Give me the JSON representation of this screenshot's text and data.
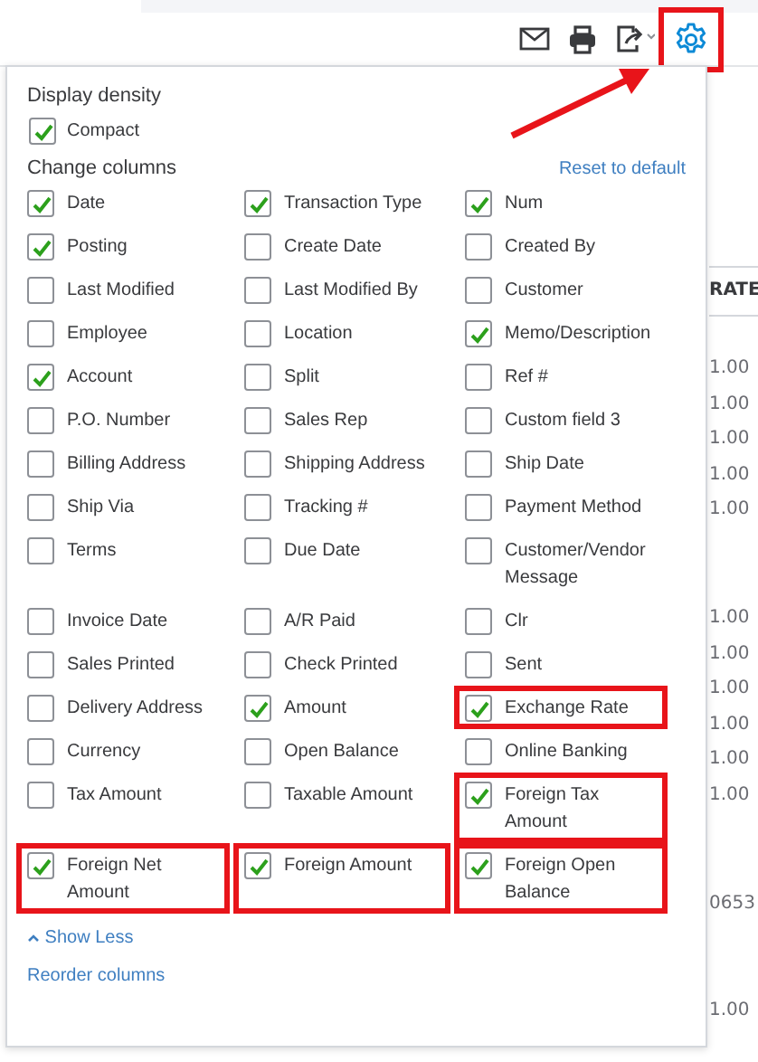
{
  "toolbar": {
    "icons": [
      {
        "kind": "mail"
      },
      {
        "kind": "print"
      },
      {
        "kind": "export"
      },
      {
        "kind": "settings",
        "highlighted": true
      }
    ]
  },
  "annotation": {
    "arrow": true
  },
  "table_background": {
    "header": "RATE",
    "groups": [
      [
        "1.00",
        "1.00",
        "1.00",
        "1.00",
        "1.00"
      ],
      [
        "1.00",
        "1.00",
        "1.00",
        "1.00",
        "1.00",
        "1.00"
      ],
      [
        "0653"
      ],
      [
        "1.00"
      ]
    ]
  },
  "display_density": {
    "label": "Display density",
    "options": [
      {
        "label": "Compact",
        "checked": true
      }
    ]
  },
  "change_columns": {
    "label": "Change columns",
    "reset_link": "Reset to default",
    "items": [
      {
        "label": "Date",
        "checked": true,
        "highlighted": false
      },
      {
        "label": "Transaction Type",
        "checked": true,
        "highlighted": false
      },
      {
        "label": "Num",
        "checked": true,
        "highlighted": false
      },
      {
        "label": "Posting",
        "checked": true,
        "highlighted": false
      },
      {
        "label": "Create Date",
        "checked": false,
        "highlighted": false
      },
      {
        "label": "Created By",
        "checked": false,
        "highlighted": false
      },
      {
        "label": "Last Modified",
        "checked": false,
        "highlighted": false
      },
      {
        "label": "Last Modified By",
        "checked": false,
        "highlighted": false
      },
      {
        "label": "Customer",
        "checked": false,
        "highlighted": false
      },
      {
        "label": "Employee",
        "checked": false,
        "highlighted": false
      },
      {
        "label": "Location",
        "checked": false,
        "highlighted": false
      },
      {
        "label": "Memo/Description",
        "checked": true,
        "highlighted": false
      },
      {
        "label": "Account",
        "checked": true,
        "highlighted": false
      },
      {
        "label": "Split",
        "checked": false,
        "highlighted": false
      },
      {
        "label": "Ref #",
        "checked": false,
        "highlighted": false
      },
      {
        "label": "P.O. Number",
        "checked": false,
        "highlighted": false
      },
      {
        "label": "Sales Rep",
        "checked": false,
        "highlighted": false
      },
      {
        "label": "Custom field 3",
        "checked": false,
        "highlighted": false
      },
      {
        "label": "Billing Address",
        "checked": false,
        "highlighted": false
      },
      {
        "label": "Shipping Address",
        "checked": false,
        "highlighted": false
      },
      {
        "label": "Ship Date",
        "checked": false,
        "highlighted": false
      },
      {
        "label": "Ship Via",
        "checked": false,
        "highlighted": false
      },
      {
        "label": "Tracking #",
        "checked": false,
        "highlighted": false
      },
      {
        "label": "Payment Method",
        "checked": false,
        "highlighted": false
      },
      {
        "label": "Terms",
        "checked": false,
        "highlighted": false
      },
      {
        "label": "Due Date",
        "checked": false,
        "highlighted": false
      },
      {
        "label": "Customer/Vendor Message",
        "checked": false,
        "highlighted": false
      },
      {
        "label": "Invoice Date",
        "checked": false,
        "highlighted": false
      },
      {
        "label": "A/R Paid",
        "checked": false,
        "highlighted": false
      },
      {
        "label": "Clr",
        "checked": false,
        "highlighted": false
      },
      {
        "label": "Sales Printed",
        "checked": false,
        "highlighted": false
      },
      {
        "label": "Check Printed",
        "checked": false,
        "highlighted": false
      },
      {
        "label": "Sent",
        "checked": false,
        "highlighted": false
      },
      {
        "label": "Delivery Address",
        "checked": false,
        "highlighted": false
      },
      {
        "label": "Amount",
        "checked": true,
        "highlighted": false
      },
      {
        "label": "Exchange Rate",
        "checked": true,
        "highlighted": true
      },
      {
        "label": "Currency",
        "checked": false,
        "highlighted": false
      },
      {
        "label": "Open Balance",
        "checked": false,
        "highlighted": false
      },
      {
        "label": "Online Banking",
        "checked": false,
        "highlighted": false
      },
      {
        "label": "Tax Amount",
        "checked": false,
        "highlighted": false
      },
      {
        "label": "Taxable Amount",
        "checked": false,
        "highlighted": false
      },
      {
        "label": "Foreign Tax Amount",
        "checked": true,
        "highlighted": true
      },
      {
        "label": "Foreign Net Amount",
        "checked": true,
        "highlighted": true
      },
      {
        "label": "Foreign Amount",
        "checked": true,
        "highlighted": true
      },
      {
        "label": "Foreign Open Balance",
        "checked": true,
        "highlighted": true
      }
    ],
    "show_less": "Show Less",
    "reorder": "Reorder columns"
  }
}
